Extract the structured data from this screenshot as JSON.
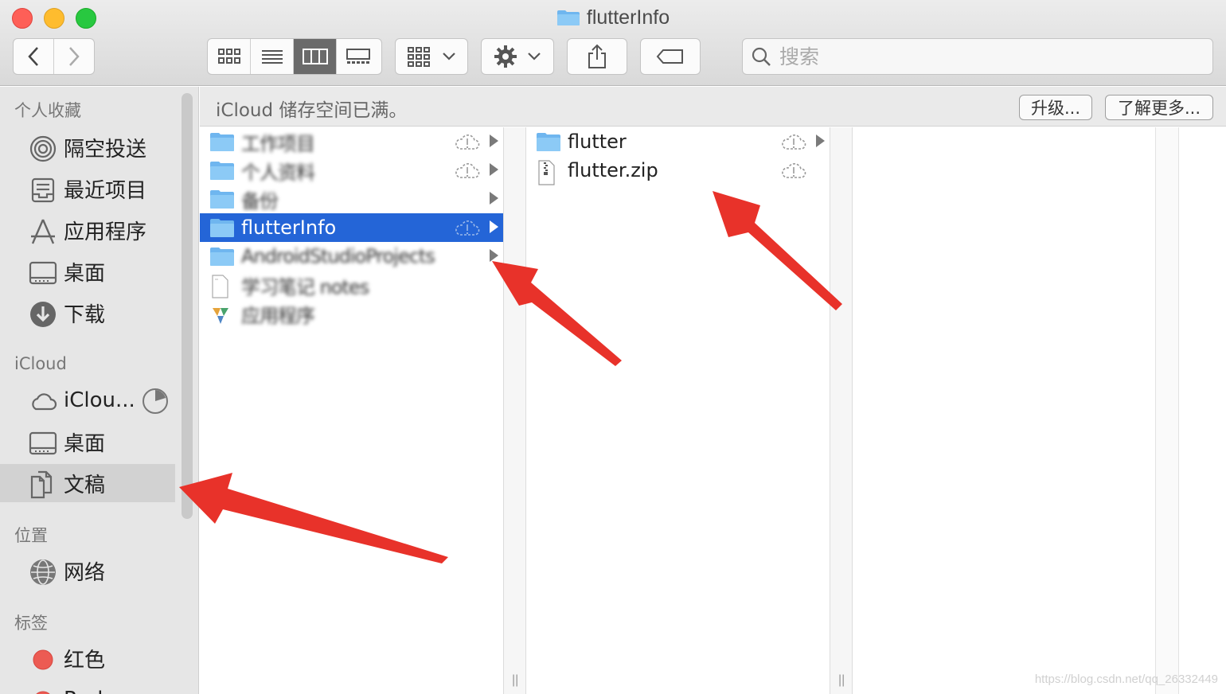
{
  "window": {
    "title": "flutterInfo"
  },
  "toolbar": {
    "search_placeholder": "搜索"
  },
  "sidebar": {
    "favorites_header": "个人收藏",
    "favorites": [
      {
        "label": "隔空投送",
        "icon": "airdrop-icon"
      },
      {
        "label": "最近项目",
        "icon": "recents-icon"
      },
      {
        "label": "应用程序",
        "icon": "applications-icon"
      },
      {
        "label": "桌面",
        "icon": "desktop-icon"
      },
      {
        "label": "下载",
        "icon": "downloads-icon"
      }
    ],
    "icloud_header": "iCloud",
    "icloud": [
      {
        "label": "iClou...",
        "icon": "icloud-drive-icon"
      },
      {
        "label": "桌面",
        "icon": "desktop-icon"
      },
      {
        "label": "文稿",
        "icon": "documents-icon",
        "selected": true
      }
    ],
    "locations_header": "位置",
    "locations": [
      {
        "label": "网络",
        "icon": "network-icon"
      }
    ],
    "tags_header": "标签",
    "tags": [
      {
        "label": "红色",
        "color": "#ec5b53"
      },
      {
        "label": "Red",
        "color": "#ec5b53"
      }
    ]
  },
  "banner": {
    "text": "iCloud 储存空间已满。",
    "upgrade_label": "升级...",
    "learn_more_label": "了解更多..."
  },
  "column1": {
    "items": [
      {
        "name": "工作项目",
        "type": "folder",
        "cloud": true,
        "arrow": true,
        "blurred": true
      },
      {
        "name": "个人资料",
        "type": "folder",
        "cloud": true,
        "arrow": true,
        "blurred": true
      },
      {
        "name": "备份",
        "type": "folder",
        "cloud": false,
        "arrow": true,
        "blurred": true
      },
      {
        "name": "flutterInfo",
        "type": "folder",
        "cloud": true,
        "arrow": true,
        "selected": true
      },
      {
        "name": "AndroidStudioProjects",
        "type": "folder",
        "cloud": false,
        "arrow": true,
        "blurred": true
      },
      {
        "name": "学习笔记 notes",
        "type": "file",
        "cloud": false,
        "arrow": false,
        "blurred": true
      },
      {
        "name": "应用程序",
        "type": "app",
        "cloud": false,
        "arrow": false,
        "blurred": true
      }
    ]
  },
  "column2": {
    "items": [
      {
        "name": "flutter",
        "type": "folder",
        "cloud": true,
        "arrow": true
      },
      {
        "name": "flutter.zip",
        "type": "zip",
        "cloud": true,
        "arrow": false
      }
    ]
  },
  "watermark": "https://blog.csdn.net/qq_26332449",
  "annotation_color": "#e8322a"
}
